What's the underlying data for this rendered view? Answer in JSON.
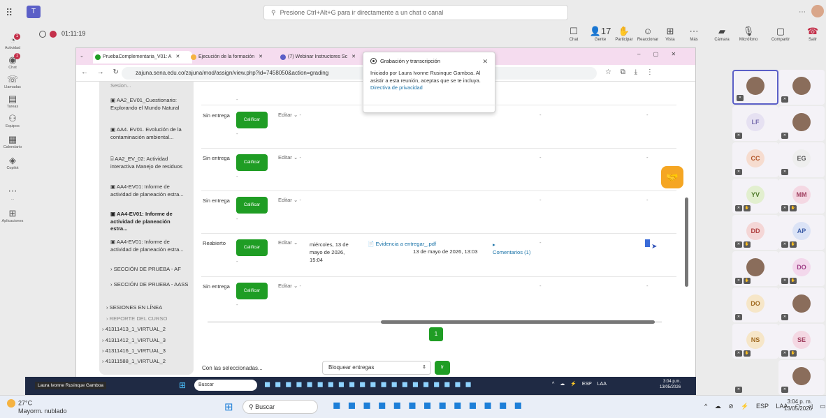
{
  "teams": {
    "search_placeholder": "Presione Ctrl+Alt+G para ir directamente a un chat o canal",
    "timer": "01:11:19",
    "rail": [
      {
        "label": "Actividad",
        "badge": "1"
      },
      {
        "label": "Chat",
        "badge": "1"
      },
      {
        "label": "Llamadas"
      },
      {
        "label": "Tareas"
      },
      {
        "label": "Equipos"
      },
      {
        "label": "Calendario"
      },
      {
        "label": "Copilot"
      },
      {
        "label": "..."
      },
      {
        "label": "Aplicaciones"
      }
    ],
    "meeting_buttons": [
      {
        "label": "Chat",
        "glyph": "☐"
      },
      {
        "label": "Gente",
        "glyph": "👤17"
      },
      {
        "label": "Participar",
        "glyph": "✋"
      },
      {
        "label": "Reaccionar",
        "glyph": "☺"
      },
      {
        "label": "Vista",
        "glyph": "⊞"
      },
      {
        "label": "Más",
        "glyph": "⋯"
      },
      {
        "label": "Cámara",
        "glyph": "▰"
      },
      {
        "label": "Micrófono",
        "glyph": "🎙"
      },
      {
        "label": "Compartir",
        "glyph": "▢"
      }
    ],
    "leave_label": "Salir",
    "participants": [
      {
        "initials": "",
        "photo": true
      },
      {
        "initials": "",
        "photo": true
      },
      {
        "initials": "LF",
        "color": "#7a6fb0",
        "bg": "#e6e1f2"
      },
      {
        "initials": "",
        "photo": true
      },
      {
        "initials": "CC",
        "color": "#b4572a",
        "bg": "#f6dccf"
      },
      {
        "initials": "EG",
        "color": "#555555",
        "bg": "#eeeeee"
      },
      {
        "initials": "YV",
        "color": "#4f7a2a",
        "bg": "#e2efcf"
      },
      {
        "initials": "MM",
        "color": "#a04060",
        "bg": "#f4d8e3"
      },
      {
        "initials": "DD",
        "color": "#b04040",
        "bg": "#f4d6d6"
      },
      {
        "initials": "AP",
        "color": "#3e5ea8",
        "bg": "#dbe3f6"
      },
      {
        "initials": "",
        "photo": true
      },
      {
        "initials": "DO",
        "color": "#a04088",
        "bg": "#f3d8ec"
      },
      {
        "initials": "DO",
        "color": "#a06a20",
        "bg": "#f6e6c8"
      },
      {
        "initials": "",
        "photo": true
      },
      {
        "initials": "NS",
        "color": "#a06a20",
        "bg": "#f6e6c8"
      },
      {
        "initials": "SE",
        "color": "#a04060",
        "bg": "#f4d8e3"
      },
      {
        "initials": "",
        "photo": true
      }
    ]
  },
  "browser": {
    "tabs": [
      {
        "label": "PruebaComplementaria_V01: A",
        "color": "#1f9d24",
        "active": true
      },
      {
        "label": "Ejecución de la formación",
        "color": "#f5b342"
      },
      {
        "label": "(7) Webinar Instructores Sc",
        "color": "#5b5fc7"
      }
    ],
    "url": "zajuna.sena.edu.co/zajuna/mod/assign/view.php?id=7458050&action=grading"
  },
  "recording_popup": {
    "title": "Grabación y transcripción",
    "body": "Iniciado por Laura Ivonne Rusinque Gamboa. Al asistir a esta reunión, aceptas que se te incluya.",
    "link": "Directiva de privacidad"
  },
  "sidebar": {
    "items": [
      {
        "text": "Sesion..."
      },
      {
        "text": "AA2_EV01_Cuestionario: Explorando el Mundo Natural"
      },
      {
        "text": "AA4. EV01. Evolución de la contaminación ambiental..."
      },
      {
        "text": "AA2_EV_02: Actividad interactiva Manejo de residuos"
      },
      {
        "text": "AA4-EV01: Informe de actividad de planeación estra..."
      },
      {
        "text": "AA4-EV01: Informe de actividad de planeación estra...",
        "bold": true
      },
      {
        "text": "AA4-EV01: Informe de actividad de planeación estra..."
      },
      {
        "text": "SECCIÓN DE PRUEBA - AF"
      },
      {
        "text": "SECCIÓN DE PRUEBA - AASS"
      },
      {
        "text": "SESIONES EN LÍNEA"
      },
      {
        "text": "REPORTE DEL CURSO"
      },
      {
        "text": "41311413_1_VIRTUAL_2"
      },
      {
        "text": "41311412_1_VIRTUAL_3"
      },
      {
        "text": "41311416_1_VIRTUAL_3"
      },
      {
        "text": "41311588_1_VIRTUAL_2"
      }
    ]
  },
  "grading": {
    "calificar": "Calificar",
    "editar": "Editar",
    "dash": "-",
    "rows": [
      {
        "status": "Sin entrega"
      },
      {
        "status": "Sin entrega"
      },
      {
        "status": "Sin entrega"
      },
      {
        "status": "Reabierto",
        "date": "miércoles, 13 de mayo de 2026, 15:04",
        "file": "Evidencia a entregar_.pdf",
        "file_date": "13 de mayo de 2026, 13:03",
        "comments": "Comentarios (1)"
      },
      {
        "status": "Sin entrega"
      }
    ],
    "page": "1",
    "with_selected": "Con las seleccionadas...",
    "bulk_option": "Bloquear entregas",
    "go": "Ir"
  },
  "remote_taskbar": {
    "presenter": "Laura Ivonne Rusinque Gamboa",
    "search": "Buscar",
    "tray": "ESP LAA",
    "time": "3:04 p.m.",
    "date": "13/05/2026"
  },
  "host_taskbar": {
    "temp": "27°C",
    "weather": "Mayorm. nublado",
    "search": "Buscar",
    "lang1": "ESP",
    "lang2": "LAA",
    "time": "3:04 p. m.",
    "date": "13/05/2026"
  }
}
